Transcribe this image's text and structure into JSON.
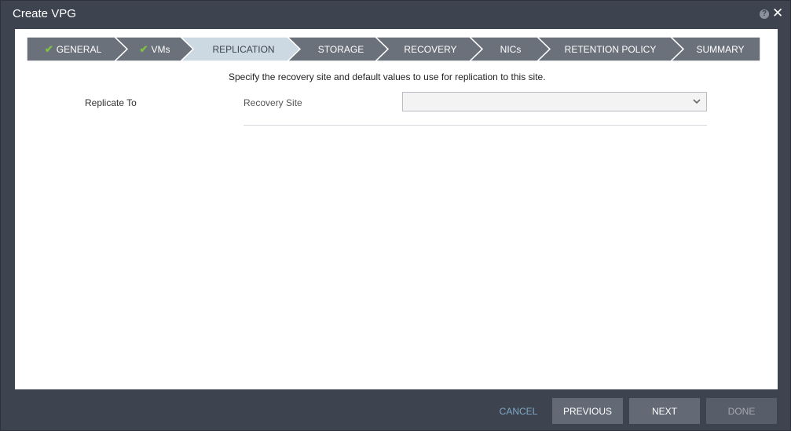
{
  "window": {
    "title": "Create VPG",
    "help_icon": "?",
    "close_icon": "✕"
  },
  "steps": [
    {
      "label": "GENERAL",
      "completed": true,
      "active": false
    },
    {
      "label": "VMs",
      "completed": true,
      "active": false
    },
    {
      "label": "REPLICATION",
      "completed": false,
      "active": true
    },
    {
      "label": "STORAGE",
      "completed": false,
      "active": false
    },
    {
      "label": "RECOVERY",
      "completed": false,
      "active": false
    },
    {
      "label": "NICs",
      "completed": false,
      "active": false
    },
    {
      "label": "RETENTION POLICY",
      "completed": false,
      "active": false
    },
    {
      "label": "SUMMARY",
      "completed": false,
      "active": false
    }
  ],
  "check_glyph": "✔",
  "main": {
    "description": "Specify the recovery site and default values to use for replication to this site.",
    "section_label": "Replicate To",
    "recovery_site": {
      "label": "Recovery Site",
      "value": ""
    }
  },
  "footer": {
    "cancel": "CANCEL",
    "previous": "PREVIOUS",
    "next": "NEXT",
    "done": "DONE"
  },
  "colors": {
    "step_bg": "#6b717b",
    "step_active_bg": "#cdd9e2",
    "check": "#7dc242",
    "accent_link": "#7fa7c4"
  }
}
